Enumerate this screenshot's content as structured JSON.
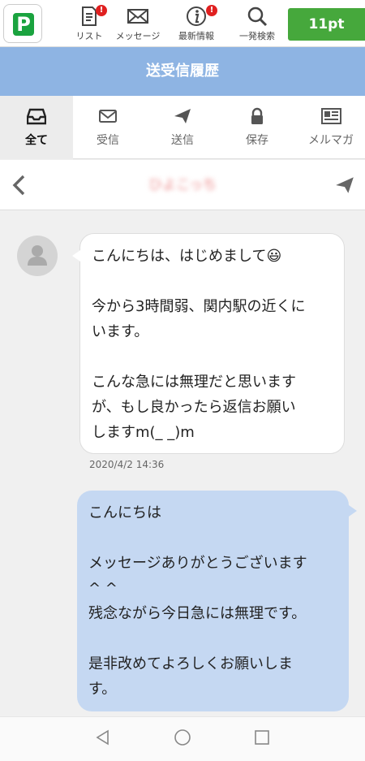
{
  "app": {
    "logo_letter": "P",
    "nav": [
      {
        "label": "リスト",
        "icon": "list-icon",
        "badge": "!"
      },
      {
        "label": "メッセージ",
        "icon": "mail-icon",
        "badge": ""
      },
      {
        "label": "最新情報",
        "icon": "info-icon",
        "badge": "!"
      },
      {
        "label": "一発検索",
        "icon": "search-icon",
        "badge": ""
      }
    ],
    "points": "11pt"
  },
  "page_title": "送受信履歴",
  "tabs": [
    {
      "label": "全て",
      "icon": "inbox-icon",
      "active": true
    },
    {
      "label": "受信",
      "icon": "envelope-icon",
      "active": false
    },
    {
      "label": "送信",
      "icon": "paper-plane-icon",
      "active": false
    },
    {
      "label": "保存",
      "icon": "lock-icon",
      "active": false
    },
    {
      "label": "メルマガ",
      "icon": "newspaper-icon",
      "active": false
    }
  ],
  "conversation": {
    "partner_name": "ひよこっち",
    "messages": [
      {
        "direction": "received",
        "text": "こんにちは、はじめまして😃\n\n今から3時間弱、関内駅の近くに\nいます。\n\nこんな急には無理だと思います\nが、もし良かったら返信お願い\nしますm(_ _)m",
        "timestamp": "2020/4/2 14:36"
      },
      {
        "direction": "sent",
        "text": "こんにちは\n\nメッセージありがとうございます\n^ ^\n残念ながら今日急には無理です。\n\n是非改めてよろしくお願いしま\nす。",
        "timestamp": ""
      }
    ]
  },
  "colors": {
    "accent_green": "#46a83c",
    "title_blue": "#8eb4e3",
    "sent_bubble": "#c5d8f2",
    "badge_red": "#e02020"
  }
}
